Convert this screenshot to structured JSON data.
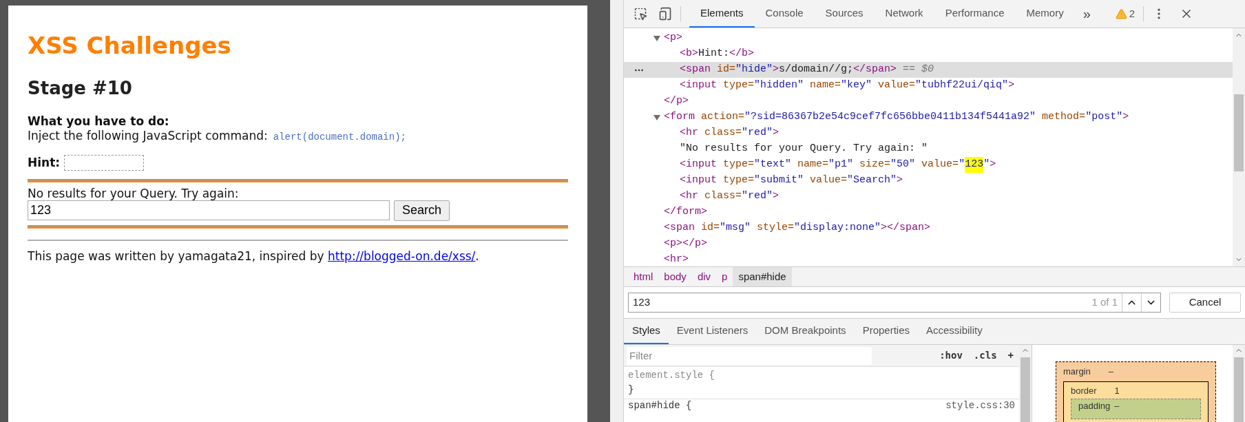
{
  "page": {
    "title": "XSS Challenges",
    "stage": "Stage #10",
    "task_heading": "What you have to do:",
    "task_text": "Inject the following JavaScript command:",
    "task_code": "alert(document.domain);",
    "hint_label": "Hint:",
    "query_message": "No results for your Query. Try again:",
    "query_input": {
      "value": "123"
    },
    "search_button": "Search",
    "footer_text": "This page was written by yamagata21, inspired by",
    "footer_link": "http://blogged-on.de/xss/",
    "footer_end": "."
  },
  "devtools": {
    "tabs": [
      {
        "label": "Elements",
        "selected": true
      },
      {
        "label": "Console",
        "selected": false
      },
      {
        "label": "Sources",
        "selected": false
      },
      {
        "label": "Network",
        "selected": false
      },
      {
        "label": "Performance",
        "selected": false
      },
      {
        "label": "Memory",
        "selected": false
      }
    ],
    "overflow": "»",
    "warning_count": "2",
    "dom_tree": [
      {
        "selected": false,
        "expanded": true,
        "open": [
          {
            "kind": "tag",
            "text": "<p>"
          }
        ],
        "close": [
          {
            "kind": "tag",
            "text": "</p>"
          }
        ],
        "children": [
          {
            "selected": false,
            "open": [
              {
                "kind": "tag",
                "text": "<b>"
              },
              {
                "kind": "plain",
                "text": "Hint:"
              },
              {
                "kind": "tag",
                "text": "</b>"
              }
            ]
          },
          {
            "selected": true,
            "open": [
              {
                "kind": "tag",
                "text": "<span"
              },
              {
                "kind": "attr",
                "text": " id="
              },
              {
                "kind": "val",
                "text": "\"hide\""
              },
              {
                "kind": "tag",
                "text": ">"
              },
              {
                "kind": "plain",
                "text": "s/domain//g;"
              },
              {
                "kind": "tag",
                "text": "</span>"
              },
              {
                "kind": "ref",
                "text": " == $0"
              }
            ]
          },
          {
            "selected": false,
            "open": [
              {
                "kind": "tag",
                "text": "<input"
              },
              {
                "kind": "attr",
                "text": " type="
              },
              {
                "kind": "val",
                "text": "\"hidden\""
              },
              {
                "kind": "attr",
                "text": " name="
              },
              {
                "kind": "val",
                "text": "\"key\""
              },
              {
                "kind": "attr",
                "text": " value="
              },
              {
                "kind": "val",
                "text": "\"tubhf22ui/qiq\""
              },
              {
                "kind": "tag",
                "text": ">"
              }
            ]
          }
        ]
      },
      {
        "selected": false,
        "expanded": true,
        "open": [
          {
            "kind": "tag",
            "text": "<form"
          },
          {
            "kind": "attr",
            "text": " action="
          },
          {
            "kind": "val",
            "text": "\"?sid=86367b2e54c9cef7fc656bbe0411b134f5441a92\""
          },
          {
            "kind": "attr",
            "text": " method="
          },
          {
            "kind": "val",
            "text": "\"post\""
          },
          {
            "kind": "tag",
            "text": ">"
          }
        ],
        "close": [
          {
            "kind": "tag",
            "text": "</form>"
          }
        ],
        "children": [
          {
            "selected": false,
            "open": [
              {
                "kind": "tag",
                "text": "<hr"
              },
              {
                "kind": "attr",
                "text": " class="
              },
              {
                "kind": "val",
                "text": "\"red\""
              },
              {
                "kind": "tag",
                "text": ">"
              }
            ]
          },
          {
            "selected": false,
            "open": [
              {
                "kind": "plain",
                "text": "\"No results for your Query. Try again: \""
              }
            ]
          },
          {
            "selected": false,
            "open": [
              {
                "kind": "tag",
                "text": "<input"
              },
              {
                "kind": "attr",
                "text": " type="
              },
              {
                "kind": "val",
                "text": "\"text\""
              },
              {
                "kind": "attr",
                "text": " name="
              },
              {
                "kind": "val",
                "text": "\"p1\""
              },
              {
                "kind": "attr",
                "text": " size="
              },
              {
                "kind": "val",
                "text": "\"50\""
              },
              {
                "kind": "attr",
                "text": " value="
              },
              {
                "kind": "val",
                "text": "\""
              },
              {
                "kind": "match",
                "text": "123"
              },
              {
                "kind": "val",
                "text": "\""
              },
              {
                "kind": "tag",
                "text": ">"
              }
            ]
          },
          {
            "selected": false,
            "open": [
              {
                "kind": "tag",
                "text": "<input"
              },
              {
                "kind": "attr",
                "text": " type="
              },
              {
                "kind": "val",
                "text": "\"submit\""
              },
              {
                "kind": "attr",
                "text": " value="
              },
              {
                "kind": "val",
                "text": "\"Search\""
              },
              {
                "kind": "tag",
                "text": ">"
              }
            ]
          },
          {
            "selected": false,
            "open": [
              {
                "kind": "tag",
                "text": "<hr"
              },
              {
                "kind": "attr",
                "text": " class="
              },
              {
                "kind": "val",
                "text": "\"red\""
              },
              {
                "kind": "tag",
                "text": ">"
              }
            ]
          }
        ]
      },
      {
        "selected": false,
        "open": [
          {
            "kind": "tag",
            "text": "<span"
          },
          {
            "kind": "attr",
            "text": " id="
          },
          {
            "kind": "val",
            "text": "\"msg\""
          },
          {
            "kind": "attr",
            "text": " style="
          },
          {
            "kind": "val",
            "text": "\"display:none\""
          },
          {
            "kind": "tag",
            "text": "></span>"
          }
        ]
      },
      {
        "selected": false,
        "open": [
          {
            "kind": "tag",
            "text": "<p></p>"
          }
        ]
      },
      {
        "selected": false,
        "open": [
          {
            "kind": "tag",
            "text": "<hr>"
          }
        ]
      }
    ],
    "breadcrumbs": [
      {
        "label": "html",
        "selected": false
      },
      {
        "label": "body",
        "selected": false
      },
      {
        "label": "div",
        "selected": false
      },
      {
        "label": "p",
        "selected": false
      },
      {
        "label": "span#hide",
        "selected": true
      }
    ],
    "find": {
      "value": "123",
      "count": "1 of 1"
    },
    "cancel": "Cancel",
    "panel_tabs": [
      {
        "label": "Styles",
        "selected": true
      },
      {
        "label": "Event Listeners",
        "selected": false
      },
      {
        "label": "DOM Breakpoints",
        "selected": false
      },
      {
        "label": "Properties",
        "selected": false
      },
      {
        "label": "Accessibility",
        "selected": false
      }
    ],
    "filter": {
      "placeholder": "Filter"
    },
    "filter_buttons": [
      ":hov",
      ".cls",
      "+"
    ],
    "rules": [
      {
        "selector": "element.style {",
        "close": "}"
      },
      {
        "selector": "span#hide {",
        "source": "style.css:30"
      }
    ],
    "box_model": {
      "margin": {
        "label": "margin",
        "value": "–"
      },
      "border": {
        "label": "border",
        "value": "1"
      },
      "padding": {
        "label": "padding",
        "value": "–"
      }
    }
  }
}
